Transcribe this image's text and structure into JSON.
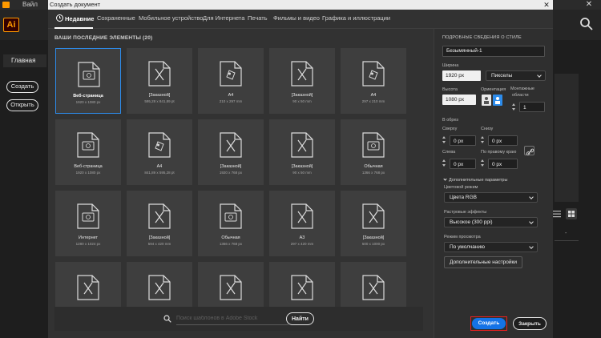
{
  "background_app": {
    "window_title": "Вайл",
    "close_glyph": "✕",
    "logo_text": "Ai",
    "home_label": "Главная",
    "create_label": "Создать",
    "open_label": "Открыть",
    "dash_text": "-"
  },
  "dialog": {
    "title": "Создать документ",
    "close_glyph": "✕",
    "tabs": [
      {
        "label": "Недавние",
        "active": true
      },
      {
        "label": "Сохраненные"
      },
      {
        "label": "Мобильное устройство"
      },
      {
        "label": "Для Интернета"
      },
      {
        "label": "Печать"
      },
      {
        "label": "Фильмы и видео"
      },
      {
        "label": "Графика и иллюстрации"
      }
    ],
    "recent_heading": "ВАШИ ПОСЛЕДНИЕ ЭЛЕМЕНТЫ  (20)",
    "items": [
      {
        "name": "Веб-страница",
        "size": "1920 x 1080 px",
        "icon": "web-icon",
        "selected": true
      },
      {
        "name": "[Заказной]",
        "size": "595,28 x 841,89 pt",
        "icon": "custom-icon"
      },
      {
        "name": "A4",
        "size": "210 x 297 mm",
        "icon": "print-icon"
      },
      {
        "name": "[Заказной]",
        "size": "90 x 50 mm",
        "icon": "custom-icon"
      },
      {
        "name": "A4",
        "size": "297 x 210 mm",
        "icon": "print-icon"
      },
      {
        "name": "Веб-страница",
        "size": "1920 x 1080 px",
        "icon": "web-icon"
      },
      {
        "name": "A4",
        "size": "841,89 x 595,28 pt",
        "icon": "print-icon"
      },
      {
        "name": "[Заказной]",
        "size": "1920 x 768 px",
        "icon": "custom-icon"
      },
      {
        "name": "[Заказной]",
        "size": "90 x 50 mm",
        "icon": "custom-icon"
      },
      {
        "name": "Обычная",
        "size": "1366 x 768 px",
        "icon": "web-icon"
      },
      {
        "name": "Интернет",
        "size": "1280 x 1024 px",
        "icon": "web-icon"
      },
      {
        "name": "[Заказной]",
        "size": "594 x 420 mm",
        "icon": "custom-icon"
      },
      {
        "name": "Обычная",
        "size": "1366 x 768 px",
        "icon": "web-icon"
      },
      {
        "name": "A3",
        "size": "297 x 420 mm",
        "icon": "custom-icon"
      },
      {
        "name": "[Заказной]",
        "size": "500 x 1000 px",
        "icon": "custom-icon"
      },
      {
        "name": "",
        "size": "",
        "icon": "custom-icon"
      },
      {
        "name": "",
        "size": "",
        "icon": "custom-icon"
      },
      {
        "name": "",
        "size": "",
        "icon": "custom-icon"
      },
      {
        "name": "",
        "size": "",
        "icon": "custom-icon"
      },
      {
        "name": "",
        "size": "",
        "icon": "custom-icon"
      }
    ],
    "stock_search": {
      "placeholder": "Поиск шаблонов в Adobe Stock",
      "button": "Найти"
    },
    "details": {
      "heading": "ПОДРОБНЫЕ СВЕДЕНИЯ О СТИЛЕ",
      "doc_name": "Безымянный-1",
      "width_label": "Ширина",
      "width_value": "1920 px",
      "units_value": "Пикселы",
      "height_label": "Высота",
      "height_value": "1080 px",
      "orientation_label": "Ориентация",
      "artboards_label_1": "Монтажные",
      "artboards_label_2": "области",
      "artboards_value": "1",
      "bleed_heading": "В обрез",
      "top_label": "Сверху",
      "top_value": "0 px",
      "bottom_label": "Снизу",
      "bottom_value": "0 px",
      "left_label": "Слева",
      "left_value": "0 px",
      "right_label": "По правому краю",
      "right_value": "0 px",
      "advanced_label": "Дополнительные параметры",
      "color_mode_label": "Цветовой режим",
      "color_mode_value": "Цвета RGB",
      "raster_label": "Растровые эффекты",
      "raster_value": "Высокое (300 ppi)",
      "preview_label": "Режим просмотра",
      "preview_value": "По умолчанию",
      "more_settings": "Дополнительные настройки"
    },
    "create_button": "Создать",
    "close_button": "Закрыть"
  },
  "colors": {
    "accent": "#1473e6",
    "selection": "#2d8ceb",
    "highlight": "#e82020",
    "brand": "#ff9a00"
  }
}
